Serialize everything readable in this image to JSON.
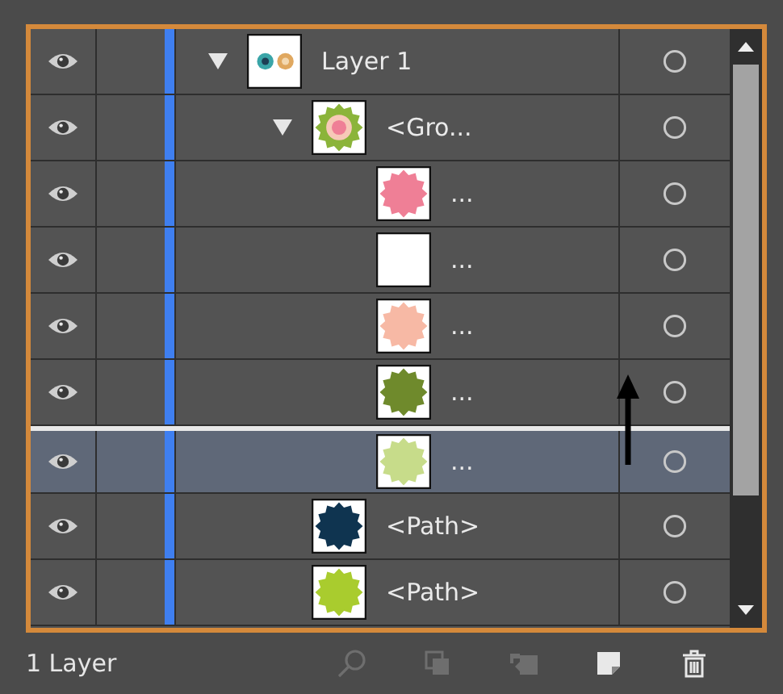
{
  "layers": [
    {
      "label": "Layer 1",
      "kind": "layer",
      "visible": true,
      "expanded": true,
      "selected": false,
      "insert_above": false,
      "children": [
        {
          "label": "<Gro...",
          "kind": "group",
          "visible": true,
          "expanded": true,
          "selected": false,
          "insert_above": false,
          "children": [
            {
              "label": "...",
              "kind": "path",
              "color": "#ef7f96",
              "visible": true,
              "selected": false,
              "insert_above": false
            },
            {
              "label": "...",
              "kind": "path",
              "color": "#ffffff",
              "visible": true,
              "selected": false,
              "insert_above": false
            },
            {
              "label": "...",
              "kind": "path",
              "color": "#f7b9a5",
              "visible": true,
              "selected": false,
              "insert_above": false
            },
            {
              "label": "...",
              "kind": "path",
              "color": "#6f8a2c",
              "visible": true,
              "selected": false,
              "insert_above": false
            },
            {
              "label": "...",
              "kind": "path",
              "color": "#c7dc8a",
              "visible": true,
              "selected": true,
              "insert_above": true
            }
          ]
        },
        {
          "label": "<Path>",
          "kind": "path",
          "color": "#0f3450",
          "visible": true,
          "selected": false,
          "insert_above": false
        },
        {
          "label": "<Path>",
          "kind": "path",
          "color": "#a9cc2e",
          "visible": true,
          "selected": false,
          "insert_above": false
        }
      ]
    }
  ],
  "status": "1 Layer",
  "footer_buttons": [
    {
      "kind": "search",
      "disabled": true
    },
    {
      "kind": "mask",
      "disabled": true
    },
    {
      "kind": "move",
      "disabled": true
    },
    {
      "kind": "new",
      "disabled": false
    },
    {
      "kind": "trash",
      "disabled": false
    }
  ]
}
